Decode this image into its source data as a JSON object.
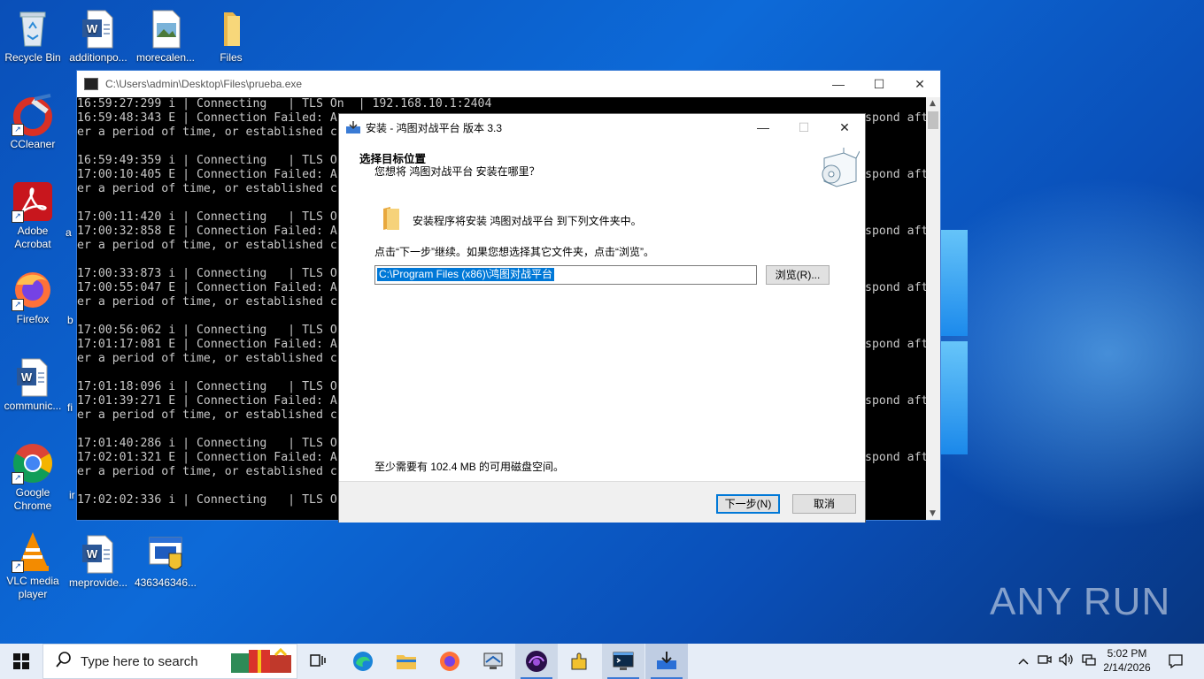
{
  "desktop": {
    "icons": [
      {
        "label": "Recycle Bin",
        "icon": "recycle-bin-icon"
      },
      {
        "label": "additionpo...",
        "icon": "word-document-icon"
      },
      {
        "label": "morecalen...",
        "icon": "image-file-icon"
      },
      {
        "label": "Files",
        "icon": "folder-icon"
      },
      {
        "label": "CCleaner",
        "icon": "ccleaner-icon"
      },
      {
        "label": "Adobe Acrobat",
        "icon": "acrobat-icon"
      },
      {
        "label": "Firefox",
        "icon": "firefox-icon"
      },
      {
        "label": "communic...",
        "icon": "word-document-icon"
      },
      {
        "label": "Google Chrome",
        "icon": "chrome-icon"
      },
      {
        "label": "VLC media player",
        "icon": "vlc-icon"
      },
      {
        "label": "meprovide...",
        "icon": "word-document-icon"
      },
      {
        "label": "436346346...",
        "icon": "installer-icon"
      }
    ],
    "partial_labels": [
      "a",
      "b",
      "fi",
      "ir"
    ]
  },
  "console": {
    "title": "C:\\Users\\admin\\Desktop\\Files\\prueba.exe",
    "lines": [
      "16:59:27:299 i | Connecting   | TLS On  | 192.168.10.1:2404",
      "16:59:48:343 E | Connection Failed: A",
      "er a period of time, or established c",
      "",
      "16:59:49:359 i | Connecting   | TLS On",
      "17:00:10:405 E | Connection Failed: A",
      "er a period of time, or established c",
      "",
      "17:00:11:420 i | Connecting   | TLS On",
      "17:00:32:858 E | Connection Failed: A",
      "er a period of time, or established c",
      "",
      "17:00:33:873 i | Connecting   | TLS On",
      "17:00:55:047 E | Connection Failed: A",
      "er a period of time, or established c",
      "",
      "17:00:56:062 i | Connecting   | TLS On",
      "17:01:17:081 E | Connection Failed: A",
      "er a period of time, or established c",
      "",
      "17:01:18:096 i | Connecting   | TLS On",
      "17:01:39:271 E | Connection Failed: A",
      "er a period of time, or established c",
      "",
      "17:01:40:286 i | Connecting   | TLS On",
      "17:02:01:321 E | Connection Failed: A",
      "er a period of time, or established c",
      "",
      "17:02:02:336 i | Connecting   | TLS On"
    ],
    "right_lines": [
      "",
      "spond aft",
      "",
      "",
      "",
      "spond aft",
      "",
      "",
      "",
      "spond aft",
      "",
      "",
      "",
      "spond aft",
      "",
      "",
      "",
      "spond aft",
      "",
      "",
      "",
      "spond aft",
      "",
      "",
      "",
      "spond aft"
    ]
  },
  "installer": {
    "title": "安装 - 鸿图对战平台 版本 3.3",
    "header_title": "选择目标位置",
    "header_subtitle": "您想将 鸿图对战平台 安装在哪里？",
    "info_text": "安装程序将安装 鸿图对战平台 到下列文件夹中。",
    "instruction": "点击“下一步”继续。如果您想选择其它文件夹，点击“浏览”。",
    "path_value": "C:\\Program Files (x86)\\鸿图对战平台",
    "browse_label": "浏览(R)...",
    "space_text": "至少需要有 102.4 MB 的可用磁盘空间。",
    "next_label": "下一步(N)",
    "cancel_label": "取消"
  },
  "taskbar": {
    "search_placeholder": "Type here to search",
    "time": "5:02 PM",
    "date": "2/14/2026"
  },
  "watermark": "ANY RUN"
}
